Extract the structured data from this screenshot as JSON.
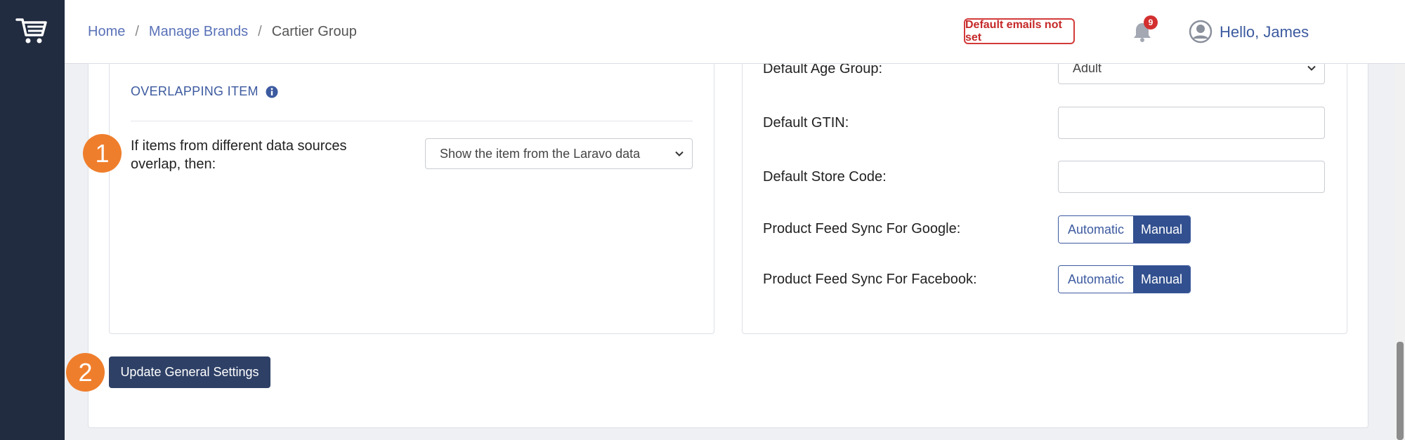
{
  "header": {
    "breadcrumb": [
      {
        "label": "Home"
      },
      {
        "label": "Manage Brands"
      },
      {
        "label": "Cartier Group"
      }
    ],
    "separator": "/",
    "warning_badge": "Default emails not set",
    "notification_count": "9",
    "greeting": "Hello, James"
  },
  "overlapping": {
    "title": "OVERLAPPING ITEM",
    "label": "If items from different data sources overlap, then:",
    "selected": "Show the item from the Laravo data"
  },
  "defaults": {
    "age_group_label": "Default Age Group:",
    "age_group_value": "Adult",
    "gtin_label": "Default GTIN:",
    "gtin_value": "",
    "store_code_label": "Default Store Code:",
    "store_code_value": "",
    "google_sync_label": "Product Feed Sync For Google:",
    "facebook_sync_label": "Product Feed Sync For Facebook:",
    "option_automatic": "Automatic",
    "option_manual": "Manual",
    "google_sync_selected": "Manual",
    "facebook_sync_selected": "Manual"
  },
  "actions": {
    "update_button": "Update General Settings"
  },
  "annotations": {
    "step1": "1",
    "step2": "2"
  },
  "colors": {
    "sidebar": "#212c40",
    "accent": "#3c5a9f",
    "step_badge": "#ef7e2c",
    "warning": "#d33a3a",
    "button": "#2e4066"
  },
  "icons": [
    "cart-logo-icon",
    "info-icon",
    "bell-icon",
    "user-avatar-icon",
    "chevron-down-icon"
  ]
}
